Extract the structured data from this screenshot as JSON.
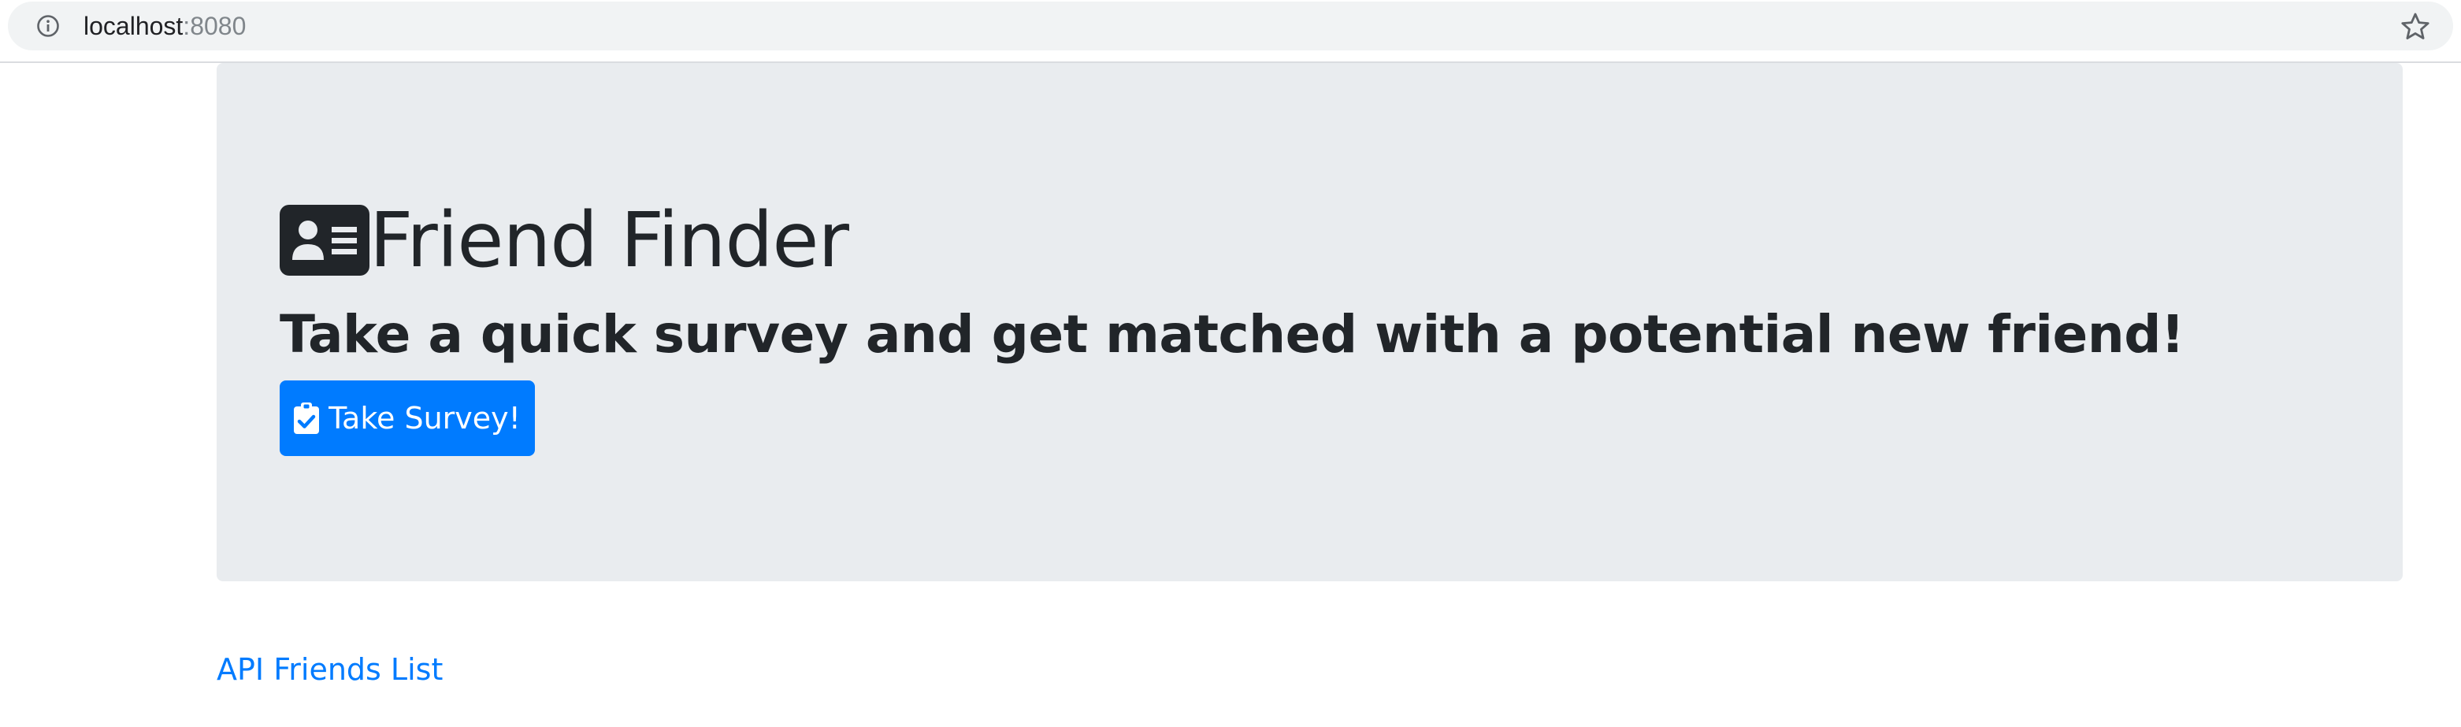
{
  "browser": {
    "url_host": "localhost",
    "url_port": ":8080",
    "info_icon": "info-circle-icon",
    "bookmark_icon": "star-outline-icon"
  },
  "jumbotron": {
    "title_icon": "id-card-icon",
    "title": "Friend Finder",
    "subtitle": "Take a quick survey and get matched with a potential new friend!",
    "button_icon": "clipboard-check-icon",
    "button_label": "Take Survey!"
  },
  "footer": {
    "api_link": "API Friends List"
  },
  "colors": {
    "jumbotron_bg": "#e9ecef",
    "primary": "#007bff",
    "text": "#212529"
  }
}
